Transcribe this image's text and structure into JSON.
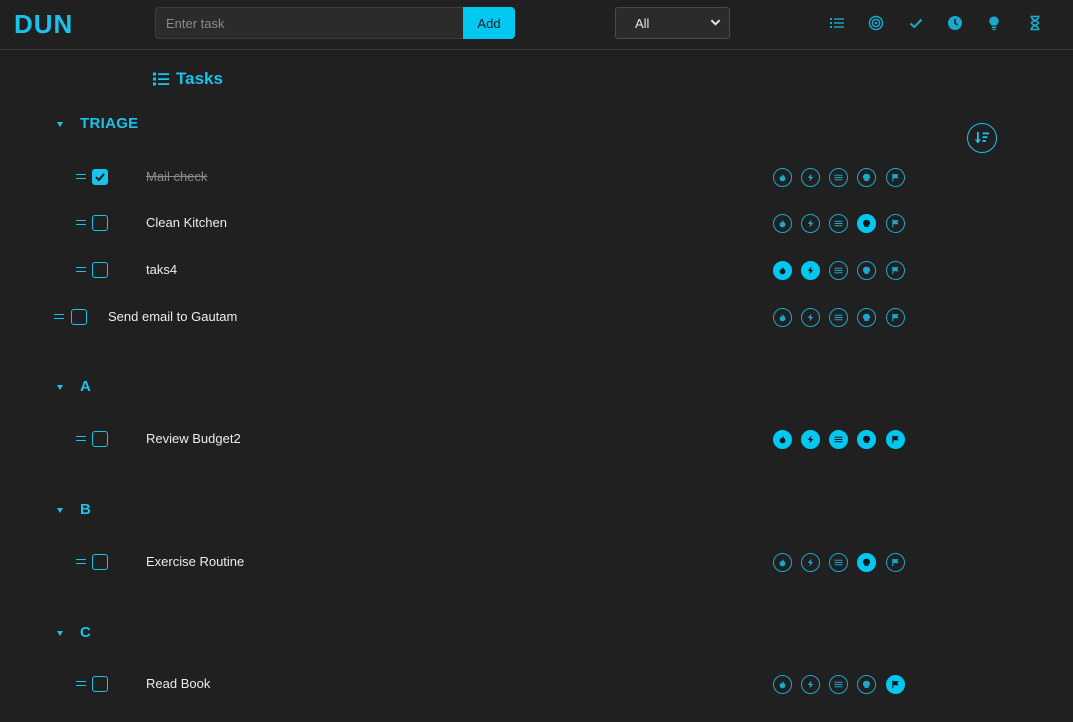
{
  "app": {
    "logo": "DUN"
  },
  "toolbar": {
    "input_placeholder": "Enter task",
    "add_label": "Add",
    "filter_value": "All"
  },
  "nav_icons": [
    "list-icon",
    "target-icon",
    "check-icon",
    "clock-icon",
    "bulb-icon",
    "hourglass-icon"
  ],
  "page": {
    "title": "Tasks"
  },
  "sections": [
    {
      "title": "TRIAGE",
      "tasks": [
        {
          "text": "Mail check",
          "done": true,
          "badges": [
            false,
            false,
            false,
            false,
            false
          ]
        },
        {
          "text": "Clean Kitchen",
          "done": false,
          "badges": [
            false,
            false,
            false,
            true,
            false
          ]
        },
        {
          "text": "taks4",
          "done": false,
          "badges": [
            true,
            true,
            false,
            false,
            false
          ]
        },
        {
          "text": "Send email to Gautam",
          "done": false,
          "badges": [
            false,
            false,
            false,
            false,
            false
          ]
        }
      ]
    },
    {
      "title": "A",
      "tasks": [
        {
          "text": "Review Budget2",
          "done": false,
          "badges": [
            true,
            true,
            true,
            true,
            true
          ]
        }
      ]
    },
    {
      "title": "B",
      "tasks": [
        {
          "text": "Exercise Routine",
          "done": false,
          "badges": [
            false,
            false,
            false,
            true,
            false
          ]
        }
      ]
    },
    {
      "title": "C",
      "tasks": [
        {
          "text": "Read Book",
          "done": false,
          "badges": [
            false,
            false,
            false,
            false,
            true
          ]
        }
      ]
    }
  ],
  "badge_icons": [
    "fire-icon",
    "bolt-icon",
    "waves-icon",
    "skull-icon",
    "flag-icon"
  ],
  "colors": {
    "accent": "#19c3ec",
    "background": "#202020"
  }
}
